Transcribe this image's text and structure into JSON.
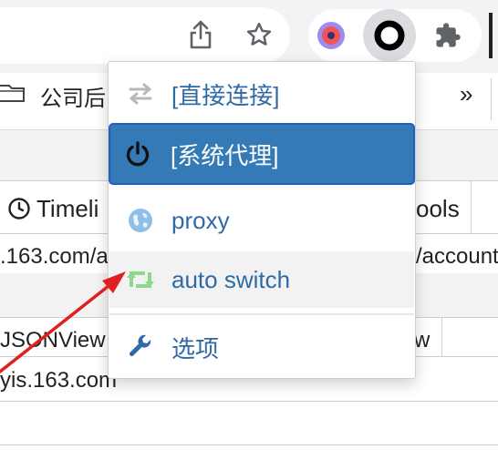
{
  "bookmarks": {
    "folder_label": "公司后",
    "overflow_label": "»"
  },
  "background": {
    "tab_timeline": "Timeli",
    "tab_tools": "ools",
    "url_left": ".163.com/a",
    "url_right": "/account",
    "tab_jsonview": "JSONView",
    "tab_right": "w",
    "domain_text": "yis.163.com"
  },
  "proxy_menu": {
    "items": [
      {
        "label": "[直接连接]",
        "icon": "direct-arrows-icon"
      },
      {
        "label": "[系统代理]",
        "icon": "power-icon"
      },
      {
        "label": "proxy",
        "icon": "globe-icon"
      },
      {
        "label": "auto switch",
        "icon": "retweet-icon"
      },
      {
        "label": "选项",
        "icon": "wrench-icon"
      }
    ]
  },
  "colors": {
    "selected_bg": "#337ab7",
    "label_blue": "#2f6aa6",
    "hover_bg": "#f2f2f2",
    "arrow_red": "#e02020",
    "auto_switch_green": "#8fd68f",
    "globe_blue": "#8fbfe8"
  }
}
